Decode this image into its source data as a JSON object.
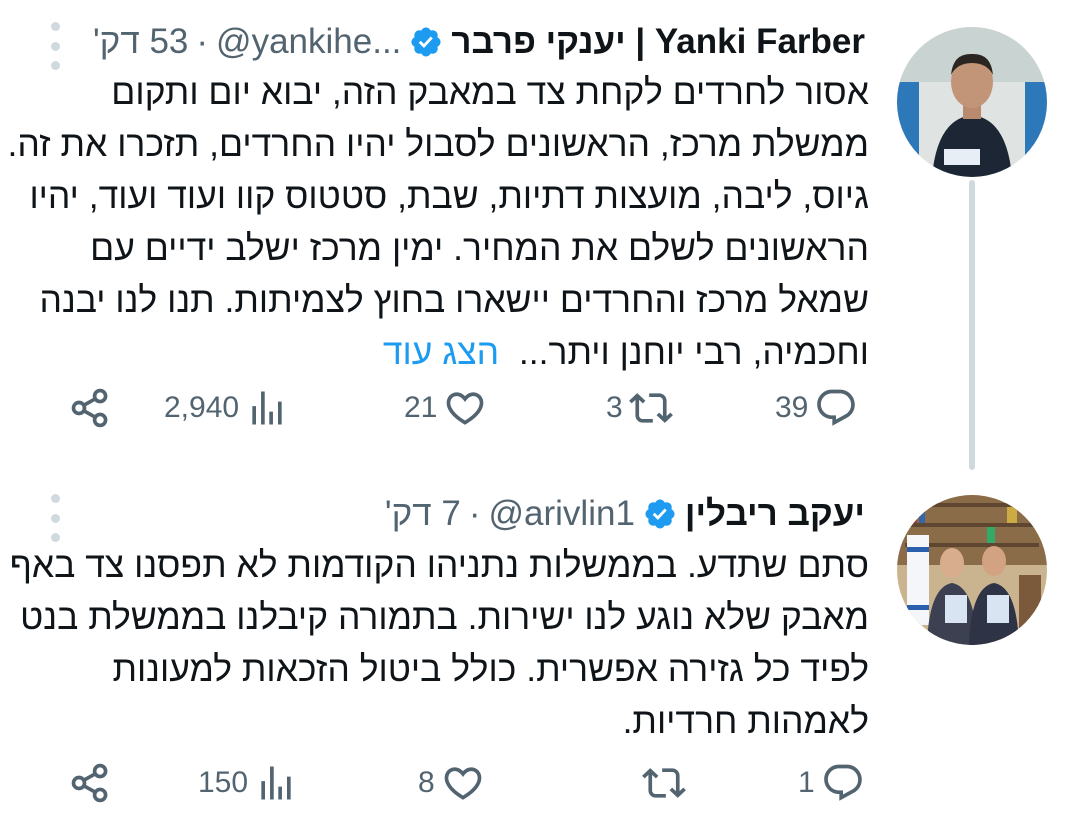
{
  "tweets": [
    {
      "author_name": "יענקי פרבר | Yanki Farber",
      "handle": "@yankihe...",
      "separator": "·",
      "time": "53 דק'",
      "body_lines": [
        "אסור לחרדים לקחת צד במאבק הזה, יבוא יום ותקום",
        "ממשלת מרכז, הראשונים לסבול יהיו החרדים, תזכרו את זה.",
        "גיוס, ליבה, מועצות דתיות, שבת, סטטוס קוו ועוד ועוד, יהיו",
        "הראשונים לשלם את המחיר. ימין מרכז ישלב ידיים עם",
        "שמאל מרכז והחרדים יישארו בחוץ לצמיתות. תנו לנו יבנה",
        "וחכמיה, רבי יוחנן ויתר..."
      ],
      "show_more": "הצג עוד",
      "replies": "39",
      "retweets": "3",
      "likes": "21",
      "views": "2,940"
    },
    {
      "author_name": "יעקב ריבלין",
      "handle": "@arivlin1",
      "separator": "·",
      "time": "7 דק'",
      "body_lines": [
        "סתם שתדע. בממשלות נתניהו הקודמות לא תפסנו צד באף",
        "מאבק שלא נוגע לנו ישירות. בתמורה קיבלנו בממשלת בנט",
        "לפיד כל גזירה אפשרית. כולל ביטול הזכאות למעונות",
        "לאמהות חרדיות."
      ],
      "replies": "1",
      "retweets": "",
      "likes": "8",
      "views": "150"
    }
  ],
  "icons": {
    "reply": "reply-bubble-icon",
    "retweet": "retweet-icon",
    "like": "heart-icon",
    "views": "analytics-bars-icon",
    "share": "share-icon",
    "more": "more-vertical-icon",
    "verified": "verified-badge-icon"
  },
  "colors": {
    "text": "#0f1419",
    "secondary": "#536471",
    "link": "#1d9bf0",
    "verified": "#1d9bf0",
    "thread_line": "#cfd9de"
  }
}
